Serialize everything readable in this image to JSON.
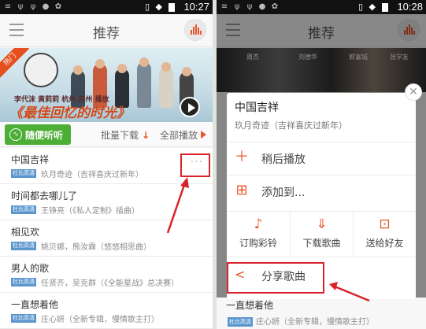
{
  "status_bar": {
    "time": "10:27"
  },
  "right_status_bar": {
    "time": "10:28"
  },
  "header": {
    "title": "推荐"
  },
  "banner": {
    "ribbon": "热门",
    "caption": "李代沫 黄莉莉 杭州 苏州 播放",
    "headline": "《最佳回忆的时光》"
  },
  "right_banner": {
    "names": [
      "周杰",
      "刘德华",
      "郭富城",
      "张学友"
    ]
  },
  "action_bar": {
    "shuffle_label": "随便听听",
    "batch_download": "批量下载",
    "play_all": "全部播放"
  },
  "songs": [
    {
      "title": "中国吉祥",
      "badge": "杜比高清",
      "artist": "玖月奇迹（吉祥喜庆过新年）"
    },
    {
      "title": "时间都去哪儿了",
      "badge": "杜比高清",
      "artist": "王铮亮（《私人定制》插曲）"
    },
    {
      "title": "相见欢",
      "badge": "杜比高清",
      "artist": "姚贝娜，熊汝霖（悠悠相思曲）"
    },
    {
      "title": "男人的歌",
      "badge": "杜比高清",
      "artist": "任贤齐，吴克群（《全能星战》总决赛）"
    },
    {
      "title": "一直想着他",
      "badge": "杜比高清",
      "artist": "庄心妍（全新专辑，慢情歌主打）"
    }
  ],
  "popup": {
    "title": "中国吉祥",
    "subtitle": "玖月奇迹（吉祥喜庆过新年）",
    "play_later": "稍后播放",
    "add_to": "添加到...",
    "ringtone": "订购彩铃",
    "download": "下载歌曲",
    "gift": "送给好友",
    "share": "分享歌曲",
    "close_glyph": "✕"
  },
  "under_row": {
    "title": "一直想着他",
    "badge": "杜比高清",
    "artist": "庄心妍（全新专辑，慢情歌主打）"
  },
  "colors": {
    "accent": "#e8562b",
    "green": "#4cae35",
    "highlight": "#d8232a",
    "badge": "#5c96cf"
  }
}
